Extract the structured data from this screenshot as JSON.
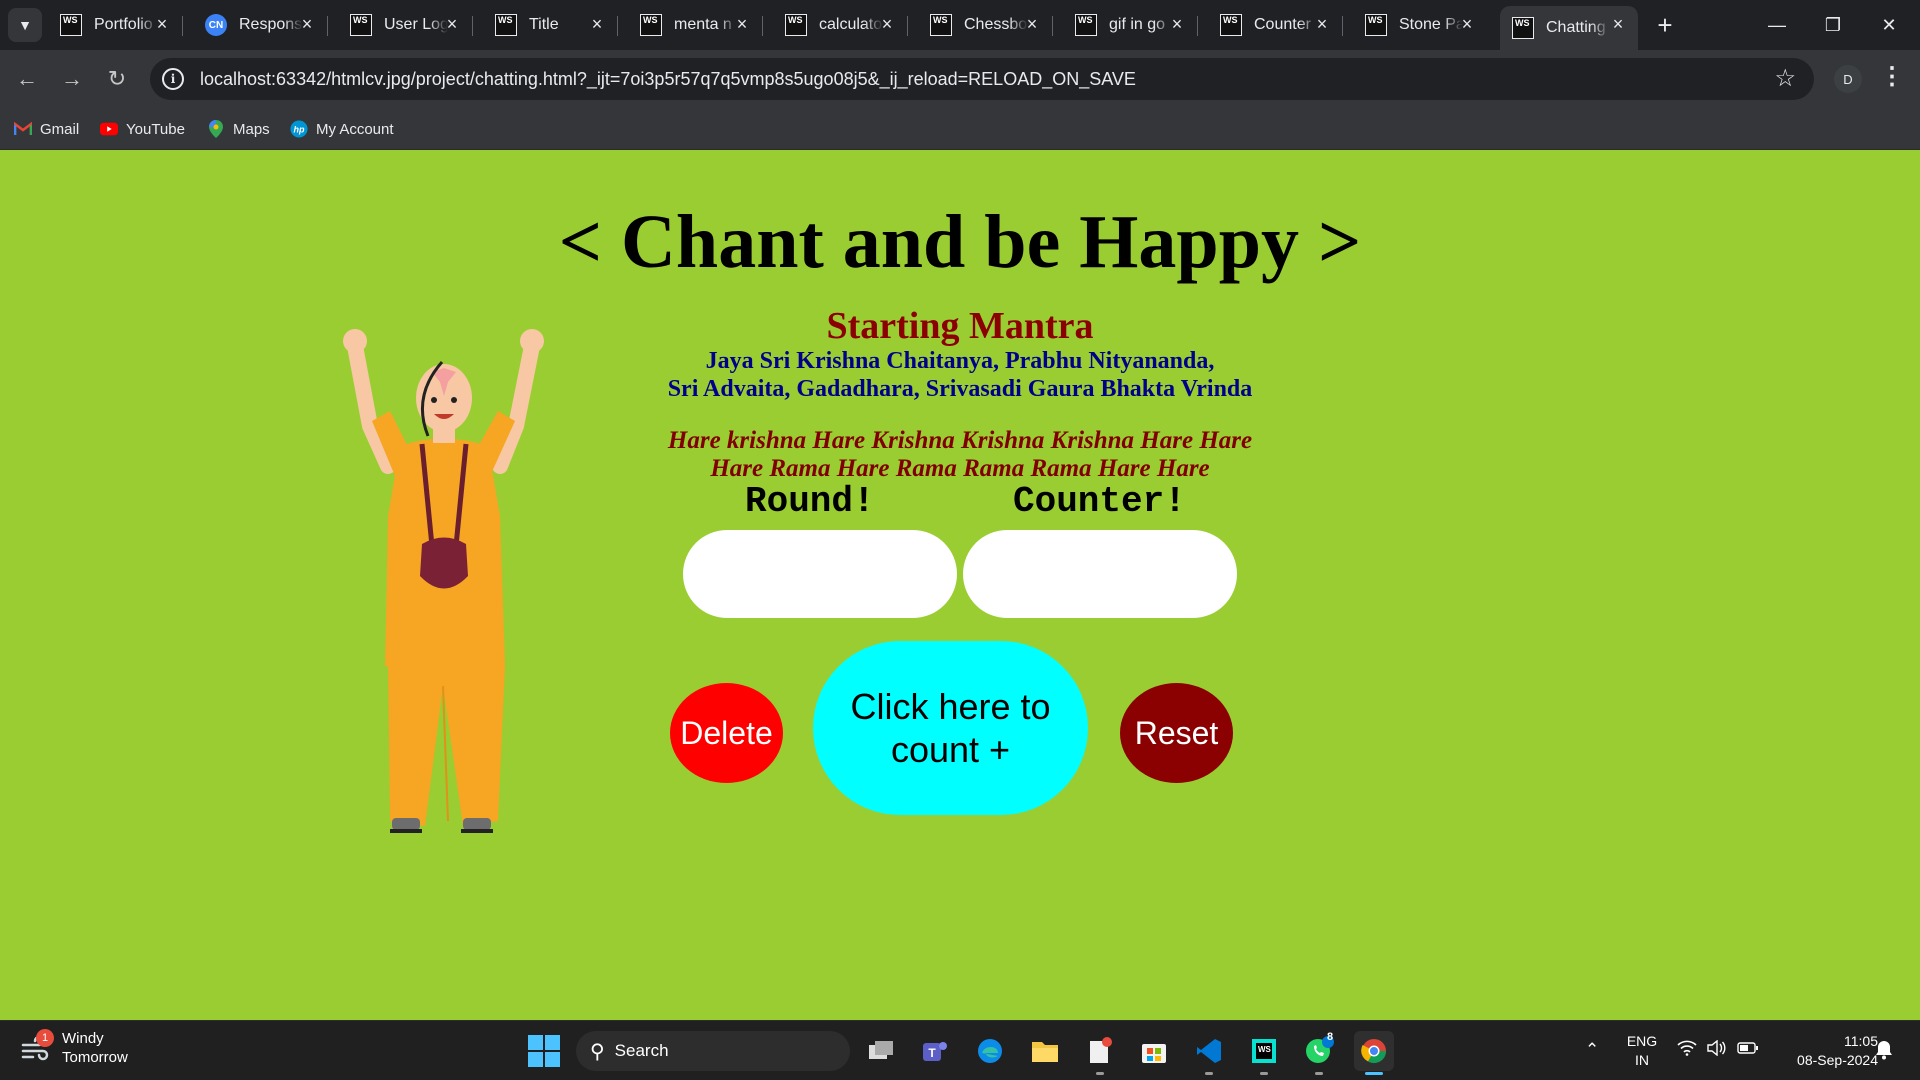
{
  "browser": {
    "tabs": [
      {
        "title": "Portfolio",
        "favicon": "WS"
      },
      {
        "title": "Responsive",
        "favicon": "spark"
      },
      {
        "title": "User Login",
        "favicon": "WS"
      },
      {
        "title": "Title",
        "favicon": "WS"
      },
      {
        "title": "menta n",
        "favicon": "WS"
      },
      {
        "title": "calculator",
        "favicon": "WS"
      },
      {
        "title": "Chessboard",
        "favicon": "WS"
      },
      {
        "title": "gif in go",
        "favicon": "WS"
      },
      {
        "title": "Counter",
        "favicon": "WS"
      },
      {
        "title": "Stone Pa",
        "favicon": "WS"
      },
      {
        "title": "Chatting",
        "favicon": "WS",
        "active": true
      }
    ],
    "favicon_ws_text": "WS",
    "favicon_spark_text": "CN",
    "url": "localhost:63342/htmlcv.jpg/project/chatting.html?_ijt=7oi3p5r57q7q5vmp8s5ugo08j5&_ij_reload=RELOAD_ON_SAVE",
    "profile_initial": "D",
    "bookmarks": [
      {
        "label": "Gmail",
        "icon": "gmail-icon"
      },
      {
        "label": "YouTube",
        "icon": "youtube-icon"
      },
      {
        "label": "Maps",
        "icon": "maps-icon"
      },
      {
        "label": "My Account",
        "icon": "hp-icon"
      }
    ]
  },
  "page": {
    "title": "< Chant and be Happy >",
    "mantra_heading": "Starting Mantra",
    "mantra_line1": "Jaya Sri Krishna Chaitanya, Prabhu Nityananda,",
    "mantra_line2": "Sri Advaita, Gadadhara, Srivasadi Gaura Bhakta Vrinda",
    "hare_line1": "Hare krishna Hare Krishna Krishna Krishna Hare Hare",
    "hare_line2": "Hare Rama Hare Rama Rama Rama Hare Hare",
    "round_label": "Round!",
    "counter_label": "Counter!",
    "round_value": "",
    "counter_value": "",
    "delete_label": "Delete",
    "count_label": "Click here to count +",
    "reset_label": "Reset",
    "colors": {
      "background": "#9acd32",
      "heading": "#8b0000",
      "mantra": "#00008b",
      "hare": "#800000",
      "delete": "#ff0000",
      "count": "#00ffff",
      "reset": "#8b0000"
    }
  },
  "taskbar": {
    "weather_title": "Windy",
    "weather_sub": "Tomorrow",
    "weather_badge": "1",
    "search_label": "Search",
    "whatsapp_badge": "8",
    "lang_top": "ENG",
    "lang_bottom": "IN",
    "time": "11:05",
    "date": "08-Sep-2024"
  }
}
